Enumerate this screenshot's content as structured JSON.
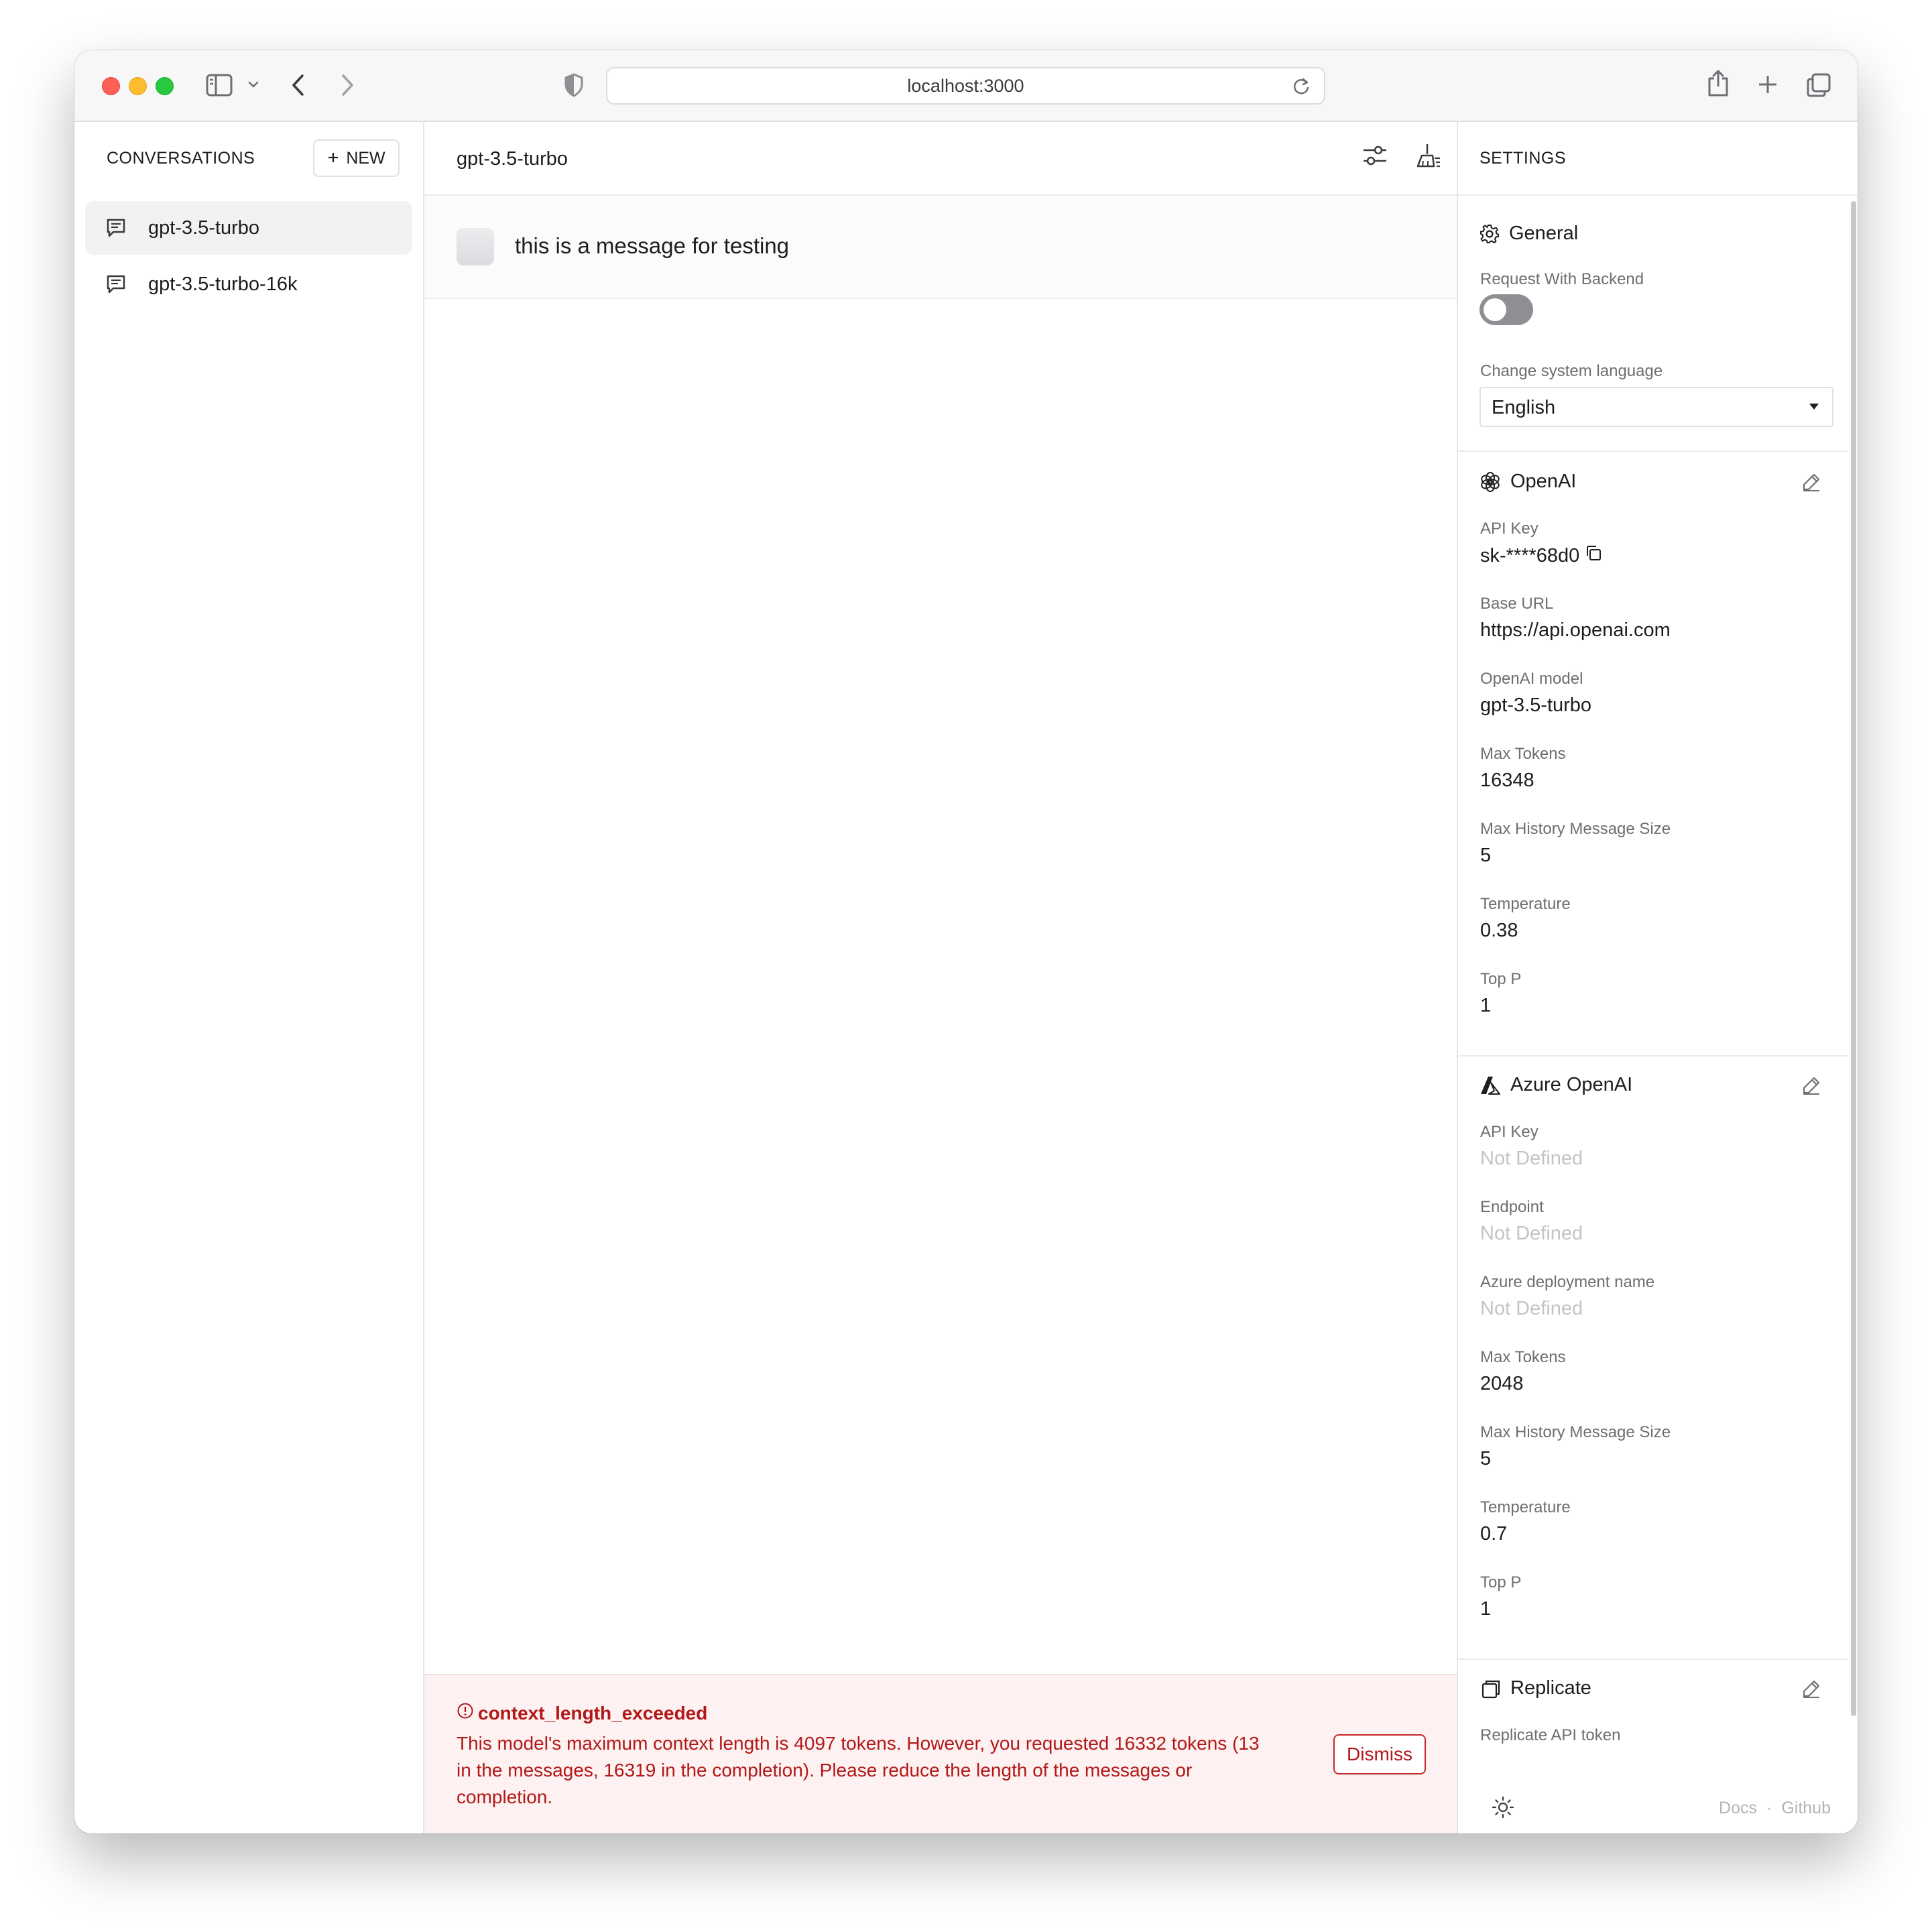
{
  "browser": {
    "url": "localhost:3000"
  },
  "sidebar": {
    "title": "CONVERSATIONS",
    "new_button_label": "NEW",
    "conversations": [
      {
        "label": "gpt-3.5-turbo",
        "active": true
      },
      {
        "label": "gpt-3.5-turbo-16k",
        "active": false
      }
    ]
  },
  "main": {
    "title": "gpt-3.5-turbo",
    "messages": [
      {
        "text": "this is a message for testing"
      }
    ],
    "error": {
      "title": "context_length_exceeded",
      "body": "This model's maximum context length is 4097 tokens. However, you requested 16332 tokens (13 in the messages, 16319 in the completion). Please reduce the length of the messages or completion.",
      "dismiss_label": "Dismiss"
    }
  },
  "settings": {
    "title": "SETTINGS",
    "general": {
      "title": "General",
      "request_with_backend_label": "Request With Backend",
      "request_with_backend": false,
      "language_label": "Change system language",
      "language_value": "English"
    },
    "openai": {
      "title": "OpenAI",
      "fields": [
        {
          "label": "API Key",
          "value": "sk-****68d0"
        },
        {
          "label": "Base URL",
          "value": "https://api.openai.com"
        },
        {
          "label": "OpenAI model",
          "value": "gpt-3.5-turbo"
        },
        {
          "label": "Max Tokens",
          "value": "16348"
        },
        {
          "label": "Max History Message Size",
          "value": "5"
        },
        {
          "label": "Temperature",
          "value": "0.38"
        },
        {
          "label": "Top P",
          "value": "1"
        }
      ]
    },
    "azure": {
      "title": "Azure OpenAI",
      "fields": [
        {
          "label": "API Key",
          "value": "Not Defined"
        },
        {
          "label": "Endpoint",
          "value": "Not Defined"
        },
        {
          "label": "Azure deployment name",
          "value": "Not Defined"
        },
        {
          "label": "Max Tokens",
          "value": "2048"
        },
        {
          "label": "Max History Message Size",
          "value": "5"
        },
        {
          "label": "Temperature",
          "value": "0.7"
        },
        {
          "label": "Top P",
          "value": "1"
        }
      ]
    },
    "replicate": {
      "title": "Replicate",
      "token_label": "Replicate API token"
    },
    "footer": {
      "docs_label": "Docs",
      "separator": "·",
      "github_label": "Github"
    }
  },
  "colors": {
    "error_text": "#b21818",
    "error_background": "#fdf1f1",
    "muted_value": "#c4c4c8",
    "toggle_off": "#8e8e93"
  },
  "icons": [
    "sidebar-toggle-icon",
    "chevron-down-icon",
    "back-icon",
    "forward-icon",
    "shield-icon",
    "reload-icon",
    "share-icon",
    "new-tab-icon",
    "tabs-overview-icon",
    "chat-bubble-icon",
    "plus-icon",
    "sliders-icon",
    "broom-icon",
    "export-icon",
    "gear-icon",
    "openai-logo-icon",
    "azure-logo-icon",
    "replicate-logo-icon",
    "pencil-icon",
    "copy-icon",
    "alert-circle-icon",
    "sun-icon"
  ]
}
